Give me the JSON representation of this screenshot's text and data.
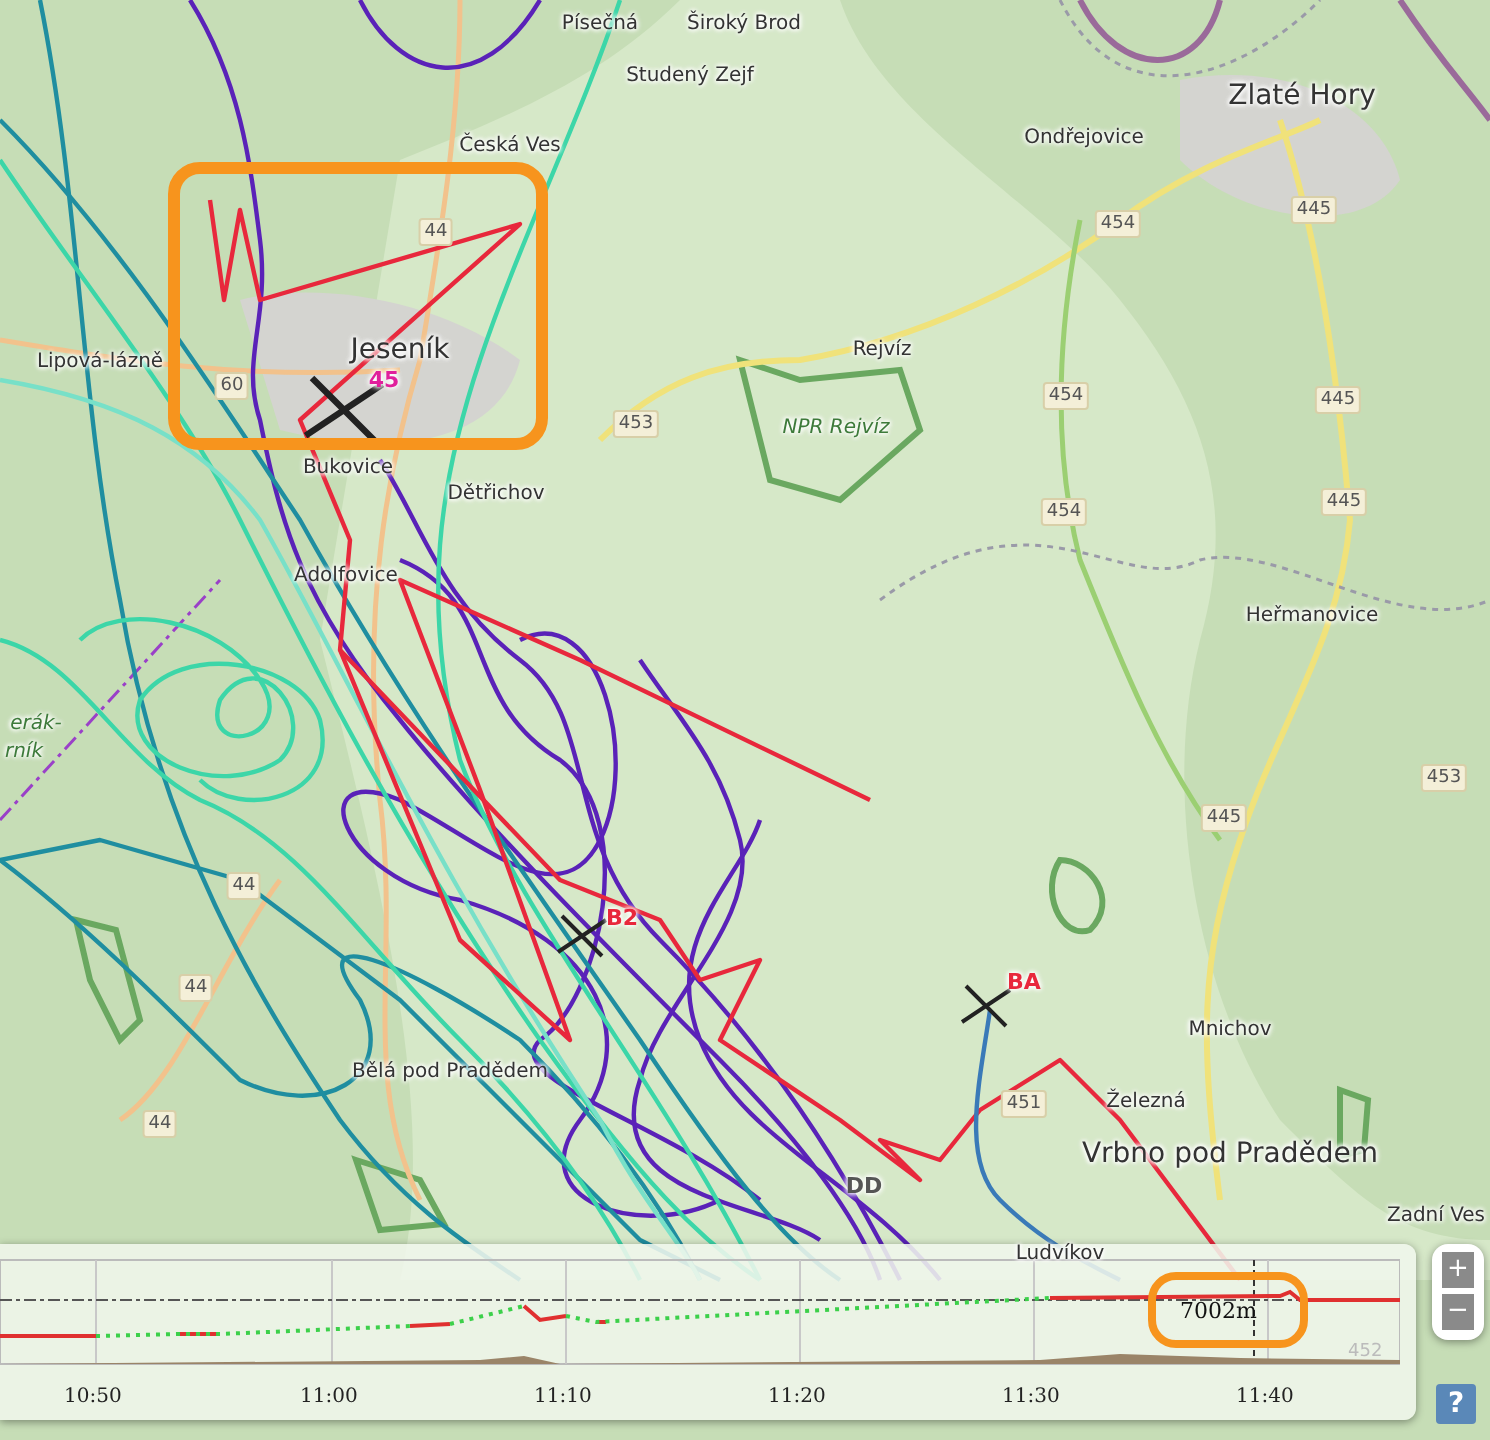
{
  "map": {
    "places": [
      {
        "name": "Písečná",
        "kind": "village"
      },
      {
        "name": "Široký Brod",
        "kind": "village"
      },
      {
        "name": "Studený Zejf",
        "kind": "village"
      },
      {
        "name": "Česká Ves",
        "kind": "village"
      },
      {
        "name": "Zlaté Hory",
        "kind": "town"
      },
      {
        "name": "Ondřejovice",
        "kind": "village"
      },
      {
        "name": "Lipová-lázně",
        "kind": "village"
      },
      {
        "name": "Jeseník",
        "kind": "town"
      },
      {
        "name": "Bukovice",
        "kind": "village"
      },
      {
        "name": "Dětřichov",
        "kind": "village"
      },
      {
        "name": "Adolfovice",
        "kind": "village"
      },
      {
        "name": "Rejvíz",
        "kind": "village"
      },
      {
        "name": "NPR Rejvíz",
        "kind": "reserve"
      },
      {
        "name": "Heřmanovice",
        "kind": "village"
      },
      {
        "name": "erák-",
        "kind": "reserve"
      },
      {
        "name": "rník",
        "kind": "reserve"
      },
      {
        "name": "Bělá pod Pradědem",
        "kind": "village"
      },
      {
        "name": "Mnichov",
        "kind": "village"
      },
      {
        "name": "Železná",
        "kind": "village"
      },
      {
        "name": "Vrbno pod Pradědem",
        "kind": "town"
      },
      {
        "name": "Zadní Ves",
        "kind": "village"
      },
      {
        "name": "Ludvíkov",
        "kind": "village"
      }
    ],
    "road_numbers": [
      "44",
      "60",
      "453",
      "454",
      "454",
      "454",
      "445",
      "445",
      "445",
      "445",
      "453",
      "44",
      "44",
      "44",
      "451"
    ],
    "gliders": [
      {
        "label": "45",
        "color": "#e0209c"
      },
      {
        "label": "B2",
        "color": "#e8283c"
      },
      {
        "label": "BA",
        "color": "#e8283c"
      },
      {
        "label": "DD",
        "color": "#555555"
      }
    ]
  },
  "barogram": {
    "time_ticks": [
      "10:50",
      "11:00",
      "11:10",
      "11:20",
      "11:30",
      "11:40"
    ],
    "altitude_reading": "7002m",
    "terrain_label": "452"
  },
  "controls": {
    "zoom_in": "+",
    "zoom_out": "−",
    "help": "?"
  }
}
